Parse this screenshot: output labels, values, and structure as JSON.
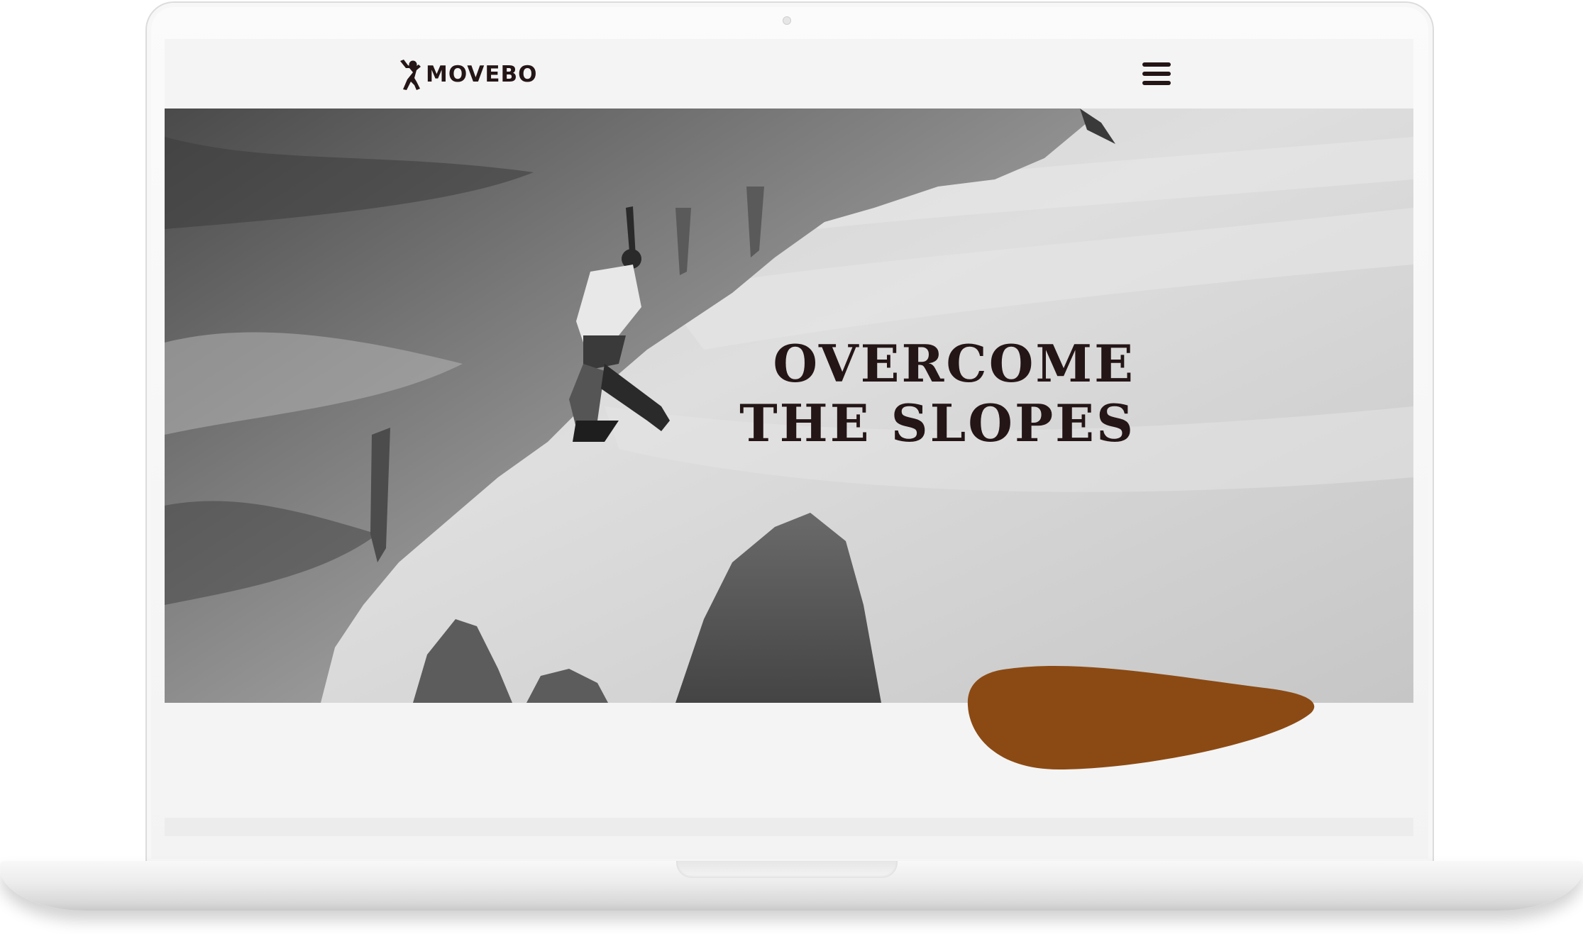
{
  "site": {
    "brand": "MOVEBO",
    "logo_icon": "climber-icon",
    "menu_icon": "hamburger-menu-icon"
  },
  "hero": {
    "title_line1": "OVERCOME",
    "title_line2": "THE SLOPES",
    "image": "grayscale photo of a climber on an overhanging rock with sea stacks below"
  },
  "colors": {
    "text_dark": "#241516",
    "accent_brown": "#8b4a14",
    "page_background": "#f4f4f4"
  }
}
